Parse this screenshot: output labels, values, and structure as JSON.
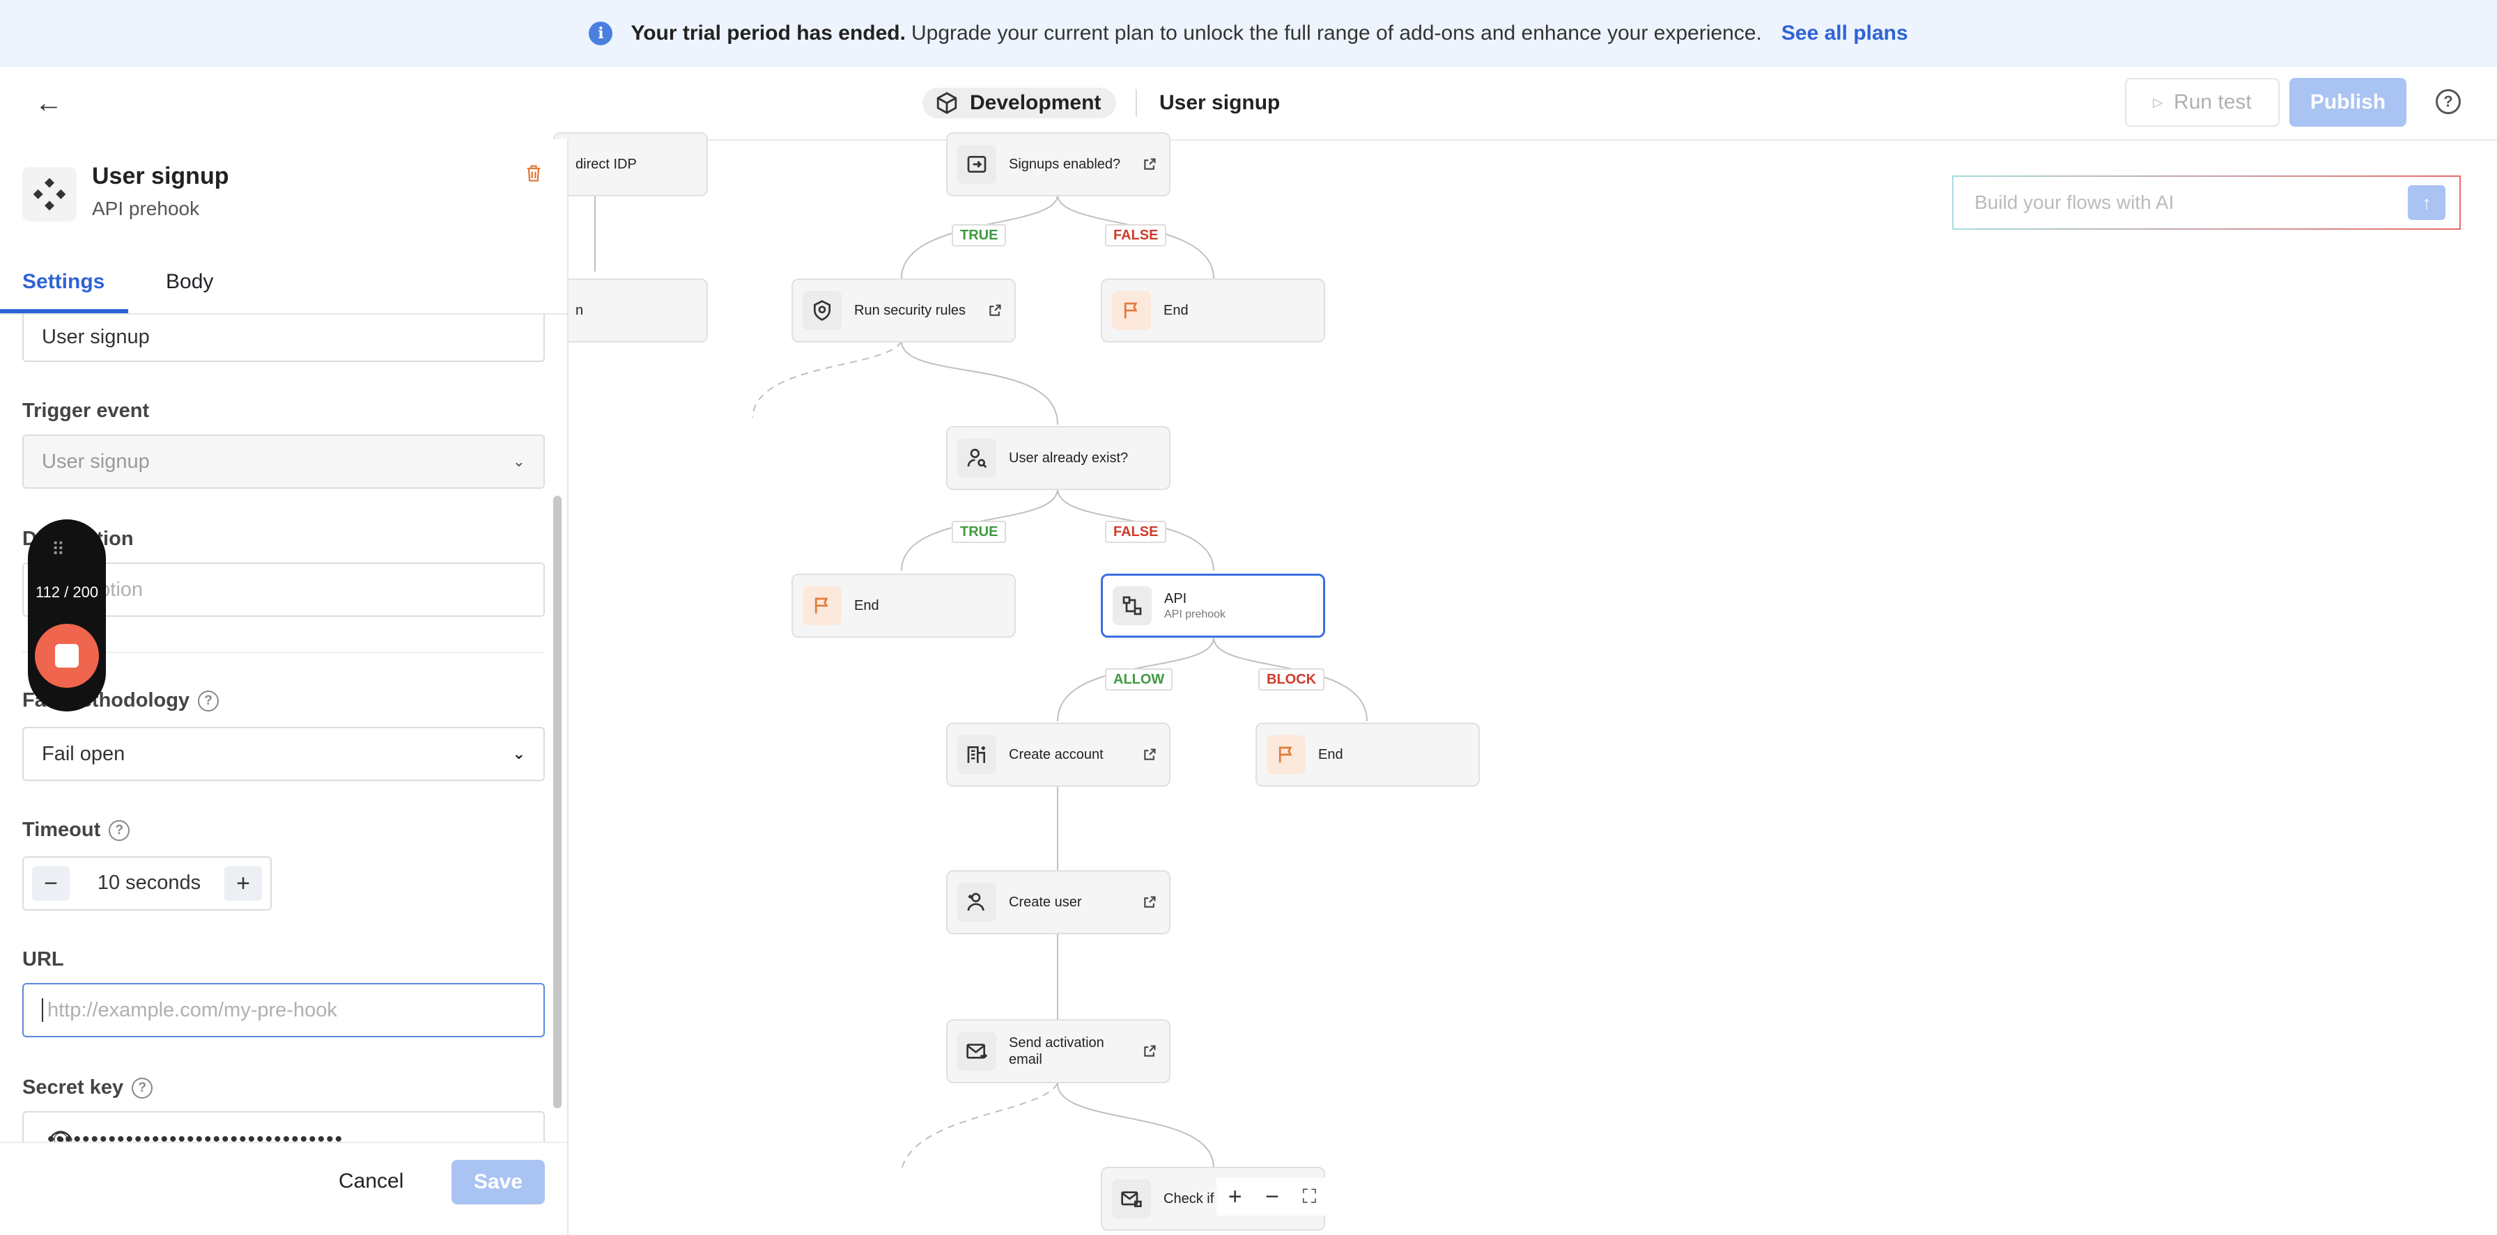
{
  "banner": {
    "icon": "info-icon",
    "bold": "Your trial period has ended.",
    "text": "Upgrade your current plan to unlock the full range of add-ons and enhance your experience.",
    "link": "See all plans"
  },
  "header": {
    "environment": "Development",
    "flow_name": "User signup",
    "run_test": "Run test",
    "publish": "Publish"
  },
  "panel": {
    "title": "User signup",
    "subtitle": "API prehook",
    "tabs": [
      {
        "label": "Settings"
      },
      {
        "label": "Body"
      }
    ],
    "name_value": "User signup",
    "trigger_label": "Trigger event",
    "trigger_value": "User signup",
    "description_label": "Description",
    "description_placeholder": "Description",
    "fail_label": "Fail methodology",
    "fail_value": "Fail open",
    "timeout_label": "Timeout",
    "timeout_value": "10 seconds",
    "url_label": "URL",
    "url_placeholder": "http://example.com/my-pre-hook",
    "secret_label": "Secret key",
    "secret_mask": "••••••••••••••••••••••••••••••••••",
    "cancel": "Cancel",
    "save": "Save"
  },
  "recorder": {
    "count": "112 / 200"
  },
  "canvas": {
    "ai_placeholder": "Build your flows with AI",
    "nodes": {
      "redirect_idp": "direct IDP",
      "signups_enabled": "Signups enabled?",
      "run_security": "Run security rules",
      "end1": "End",
      "user_exist": "User already exist?",
      "end2": "End",
      "api_title": "API",
      "api_sub": "API prehook",
      "create_account": "Create account",
      "end3": "End",
      "create_user": "Create user",
      "send_activation": "Send activation email",
      "check": "Check if"
    },
    "branches": {
      "true1": "TRUE",
      "false1": "FALSE",
      "true2": "TRUE",
      "false2": "FALSE",
      "allow": "ALLOW",
      "block": "BLOCK"
    }
  }
}
